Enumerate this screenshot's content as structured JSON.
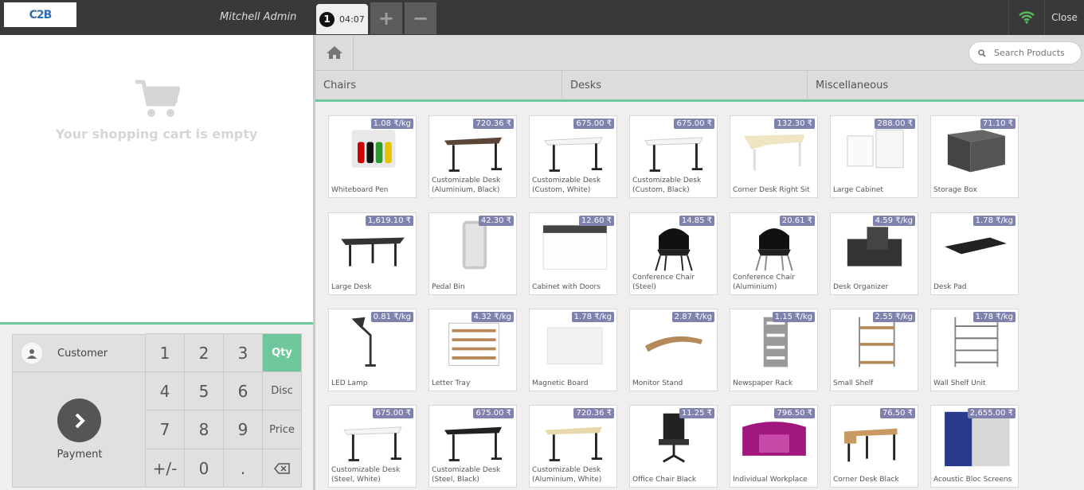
{
  "topbar": {
    "logo": "C2B",
    "user_name": "Mitchell Admin",
    "order_number": "1",
    "order_time": "04:07",
    "add_order": "+",
    "remove_order": "−",
    "close_label": "Close"
  },
  "cart": {
    "empty_text": "Your shopping cart is empty"
  },
  "actionpad": {
    "customer_label": "Customer",
    "payment_label": "Payment"
  },
  "numpad": {
    "keys": [
      "1",
      "2",
      "3",
      "Qty",
      "4",
      "5",
      "6",
      "Disc",
      "7",
      "8",
      "9",
      "Price",
      "+/-",
      "0",
      ".",
      "⌫"
    ]
  },
  "search": {
    "placeholder": "Search Products"
  },
  "categories": [
    "Chairs",
    "Desks",
    "Miscellaneous"
  ],
  "products": [
    {
      "name": "Whiteboard Pen",
      "price": "1.08 ₹/kg"
    },
    {
      "name": "Customizable Desk (Aluminium, Black)",
      "price": "720.36 ₹"
    },
    {
      "name": "Customizable Desk (Custom, White)",
      "price": "675.00 ₹"
    },
    {
      "name": "Customizable Desk (Custom, Black)",
      "price": "675.00 ₹"
    },
    {
      "name": "Corner Desk Right Sit",
      "price": "132.30 ₹"
    },
    {
      "name": "Large Cabinet",
      "price": "288.00 ₹"
    },
    {
      "name": "Storage Box",
      "price": "71.10 ₹"
    },
    {
      "name": "Large Desk",
      "price": "1,619.10 ₹"
    },
    {
      "name": "Pedal Bin",
      "price": "42.30 ₹"
    },
    {
      "name": "Cabinet with Doors",
      "price": "12.60 ₹"
    },
    {
      "name": "Conference Chair (Steel)",
      "price": "14.85 ₹"
    },
    {
      "name": "Conference Chair (Aluminium)",
      "price": "20.61 ₹"
    },
    {
      "name": "Desk Organizer",
      "price": "4.59 ₹/kg"
    },
    {
      "name": "Desk Pad",
      "price": "1.78 ₹/kg"
    },
    {
      "name": "LED Lamp",
      "price": "0.81 ₹/kg"
    },
    {
      "name": "Letter Tray",
      "price": "4.32 ₹/kg"
    },
    {
      "name": "Magnetic Board",
      "price": "1.78 ₹/kg"
    },
    {
      "name": "Monitor Stand",
      "price": "2.87 ₹/kg"
    },
    {
      "name": "Newspaper Rack",
      "price": "1.15 ₹/kg"
    },
    {
      "name": "Small Shelf",
      "price": "2.55 ₹/kg"
    },
    {
      "name": "Wall Shelf Unit",
      "price": "1.78 ₹/kg"
    },
    {
      "name": "Customizable Desk (Steel, White)",
      "price": "675.00 ₹"
    },
    {
      "name": "Customizable Desk (Steel, Black)",
      "price": "675.00 ₹"
    },
    {
      "name": "Customizable Desk (Aluminium, White)",
      "price": "720.36 ₹"
    },
    {
      "name": "Office Chair Black",
      "price": "11.25 ₹"
    },
    {
      "name": "Individual Workplace",
      "price": "796.50 ₹"
    },
    {
      "name": "Corner Desk Black",
      "price": "76.50 ₹"
    },
    {
      "name": "Acoustic Bloc Screens",
      "price": "2,655.00 ₹"
    }
  ],
  "colors": {
    "topbar": "#393939",
    "accent_green": "#6ec89b",
    "price_badge": "#7f82ac",
    "wifi": "#5cb85c"
  },
  "icons": {
    "home": "home-icon",
    "search": "search-icon",
    "wifi": "wifi-icon",
    "cart": "cart-icon",
    "customer": "user-icon",
    "payment": "chevron-right-icon",
    "backspace": "backspace-icon"
  }
}
